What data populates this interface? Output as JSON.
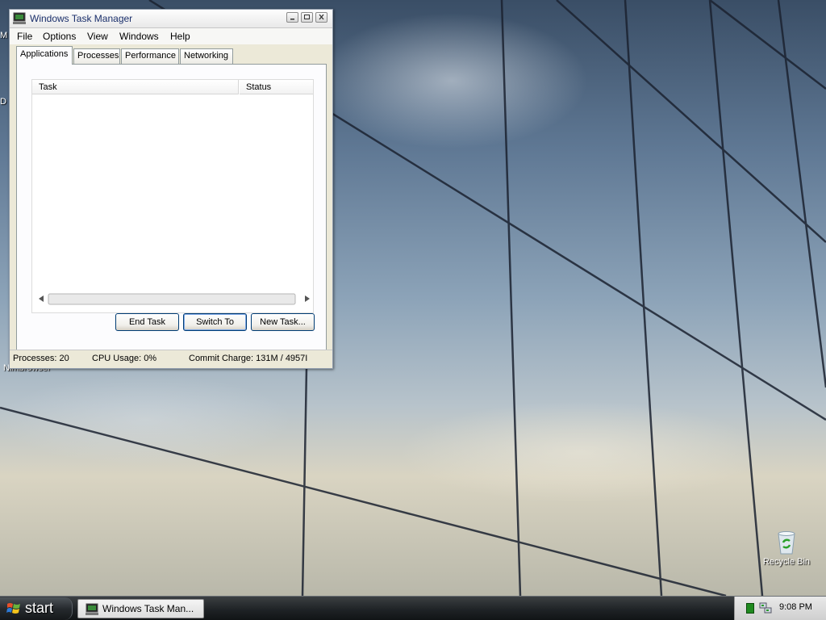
{
  "desktop": {
    "icons": [
      {
        "label": "Recycle Bin",
        "icon": "recycle-bin-icon"
      }
    ],
    "partial_labels": [
      "M",
      "D",
      "Nimbrowser"
    ]
  },
  "window": {
    "title": "Windows Task Manager",
    "icon": "task-manager-icon",
    "menu": [
      "File",
      "Options",
      "View",
      "Windows",
      "Help"
    ],
    "tabs": [
      {
        "label": "Applications",
        "active": true
      },
      {
        "label": "Processes",
        "active": false
      },
      {
        "label": "Performance",
        "active": false
      },
      {
        "label": "Networking",
        "active": false
      }
    ],
    "columns": [
      "Task",
      "Status"
    ],
    "tasks": [],
    "buttons": {
      "end_task": "End Task",
      "switch_to": "Switch To",
      "new_task": "New Task..."
    },
    "status": {
      "processes": "Processes: 20",
      "cpu": "CPU Usage: 0%",
      "commit": "Commit Charge: 131M / 4957I"
    }
  },
  "taskbar": {
    "start_label": "start",
    "task_label": "Windows Task Man...",
    "clock": "9:08 PM",
    "colors": {
      "bar": "#1d2124",
      "tray": "#d9d9d9"
    }
  }
}
